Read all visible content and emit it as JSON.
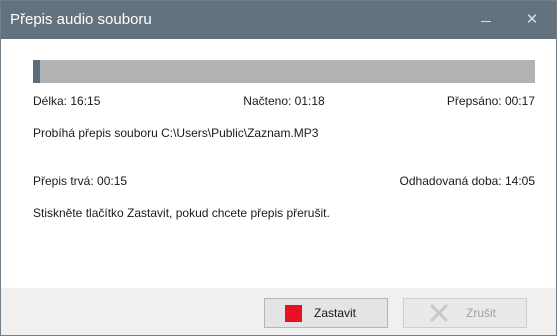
{
  "window": {
    "title": "Přepis audio souboru",
    "minimize_glyph": "—",
    "close_glyph": "✕"
  },
  "progress": {
    "fraction": 0.014,
    "fill_color": "#5b6c7a",
    "track_color": "#b3b3b3"
  },
  "stats": {
    "length": "Délka: 16:15",
    "loaded": "Načteno: 01:18",
    "transcribed": "Přepsáno: 00:17"
  },
  "status_text": "Probíhá přepis souboru C:\\Users\\Public\\Zaznam.MP3",
  "timing": {
    "elapsed": "Přepis trvá: 00:15",
    "estimated": "Odhadovaná doba: 14:05"
  },
  "hint_text": "Stiskněte tlačítko Zastavit, pokud chcete přepis přerušit.",
  "buttons": {
    "stop": {
      "label": "Zastavit",
      "icon": "stop-square-icon",
      "color": "#e81123"
    },
    "cancel": {
      "label": "Zrušit",
      "icon": "x-icon",
      "disabled": true
    }
  }
}
